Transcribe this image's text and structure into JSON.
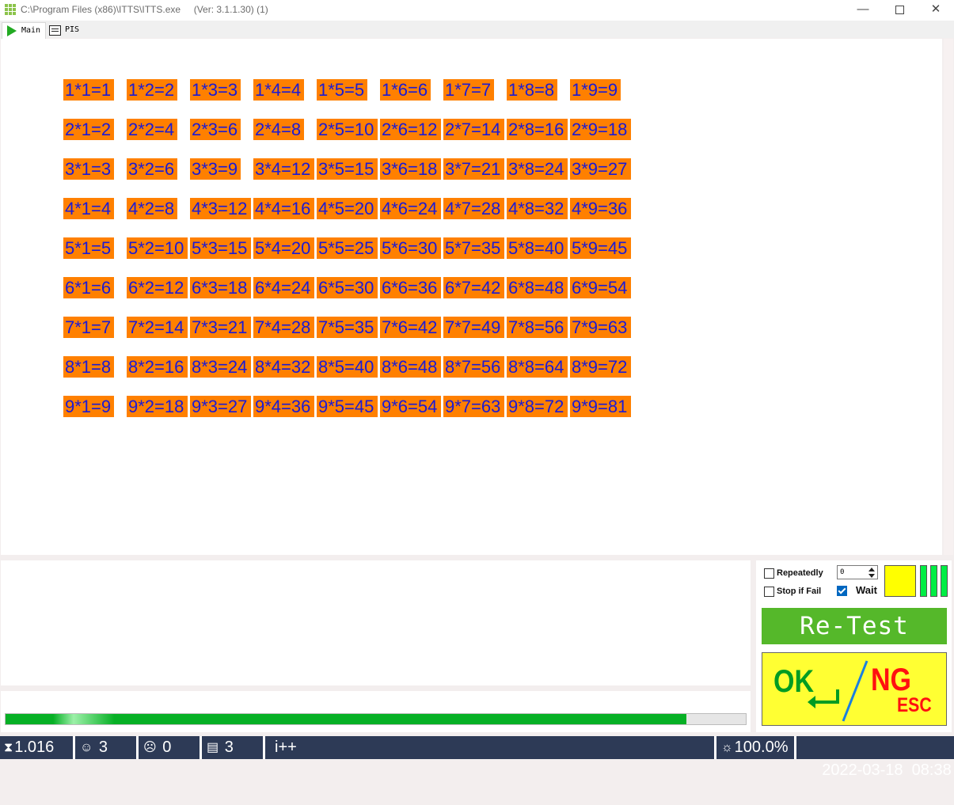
{
  "window": {
    "title": "C:\\Program Files (x86)\\ITTS\\ITTS.exe     (Ver: 3.1.1.30) (1)",
    "minimize_glyph": "—",
    "close_glyph": "✕"
  },
  "tabs": [
    {
      "label": "Main",
      "icon": "play-icon",
      "active": true
    },
    {
      "label": "PIS",
      "icon": "list-icon",
      "active": false
    }
  ],
  "table": {
    "cell_color": "#ff8000",
    "text_color": "#1a1ad6",
    "rows": [
      [
        "1*1=1",
        "1*2=2",
        "1*3=3",
        "1*4=4",
        "1*5=5",
        "1*6=6",
        "1*7=7",
        "1*8=8",
        "1*9=9"
      ],
      [
        "2*1=2",
        "2*2=4",
        "2*3=6",
        "2*4=8",
        "2*5=10",
        "2*6=12",
        "2*7=14",
        "2*8=16",
        "2*9=18"
      ],
      [
        "3*1=3",
        "3*2=6",
        "3*3=9",
        "3*4=12",
        "3*5=15",
        "3*6=18",
        "3*7=21",
        "3*8=24",
        "3*9=27"
      ],
      [
        "4*1=4",
        "4*2=8",
        "4*3=12",
        "4*4=16",
        "4*5=20",
        "4*6=24",
        "4*7=28",
        "4*8=32",
        "4*9=36"
      ],
      [
        "5*1=5",
        "5*2=10",
        "5*3=15",
        "5*4=20",
        "5*5=25",
        "5*6=30",
        "5*7=35",
        "5*8=40",
        "5*9=45"
      ],
      [
        "6*1=6",
        "6*2=12",
        "6*3=18",
        "6*4=24",
        "6*5=30",
        "6*6=36",
        "6*7=42",
        "6*8=48",
        "6*9=54"
      ],
      [
        "7*1=7",
        "7*2=14",
        "7*3=21",
        "7*4=28",
        "7*5=35",
        "7*6=42",
        "7*7=49",
        "7*8=56",
        "7*9=63"
      ],
      [
        "8*1=8",
        "8*2=16",
        "8*3=24",
        "8*4=32",
        "8*5=40",
        "8*6=48",
        "8*7=56",
        "8*8=64",
        "8*9=72"
      ],
      [
        "9*1=9",
        "9*2=18",
        "9*3=27",
        "9*4=36",
        "9*5=45",
        "9*6=54",
        "9*7=63",
        "9*8=72",
        "9*9=81"
      ]
    ]
  },
  "progress": {
    "fraction": 0.92,
    "color": "#06b025"
  },
  "controls": {
    "repeatedly": {
      "label": "Repeatedly",
      "checked": false
    },
    "stop_if_fail": {
      "label": "Stop if Fail",
      "checked": false
    },
    "wait": {
      "label": "Wait",
      "checked": true
    },
    "spin_value": "0",
    "retest_label": "Re-Test",
    "ok_label": "OK",
    "ng_label": "NG",
    "esc_label": "ESC"
  },
  "status": {
    "timer": "1.016",
    "pass_count": "3",
    "fail_count": "0",
    "total_count": "3",
    "mode": "i++",
    "percent": "100.0%",
    "datetime": "2022-03-18  08:38",
    "icons": [
      "hourglass-icon",
      "smile-icon",
      "frown-icon",
      "document-icon",
      "gear-icon"
    ]
  }
}
